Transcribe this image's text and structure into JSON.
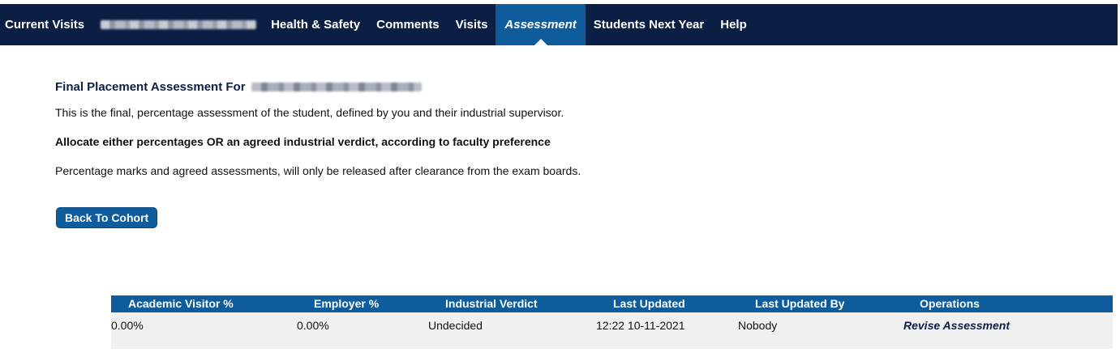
{
  "nav": {
    "items": [
      {
        "label": "Current Visits"
      },
      {
        "label": "Health & Safety"
      },
      {
        "label": "Comments"
      },
      {
        "label": "Visits"
      },
      {
        "label": "Assessment",
        "active": true
      },
      {
        "label": "Students Next Year"
      },
      {
        "label": "Help"
      }
    ]
  },
  "page": {
    "title": "Final Placement Assessment For",
    "description": "This is the final, percentage assessment of the student, defined by you and their industrial supervisor.",
    "instruction": "Allocate either percentages OR an agreed industrial verdict, according to faculty preference",
    "release_note": "Percentage marks and agreed assessments, will only be released after clearance from the exam boards.",
    "back_button": "Back To Cohort"
  },
  "table": {
    "headers": [
      "Academic Visitor %",
      "Employer %",
      "Industrial Verdict",
      "Last Updated",
      "Last Updated By",
      "Operations"
    ],
    "rows": [
      {
        "academic": "0.00%",
        "employer": "0.00%",
        "verdict": "Undecided",
        "updated": "12:22 10-11-2021",
        "updated_by": "Nobody",
        "operation": "Revise Assessment"
      }
    ]
  },
  "colors": {
    "nav_bg": "#0b1f45",
    "accent": "#0e5c9c",
    "row_bg": "#f0f0f0"
  }
}
